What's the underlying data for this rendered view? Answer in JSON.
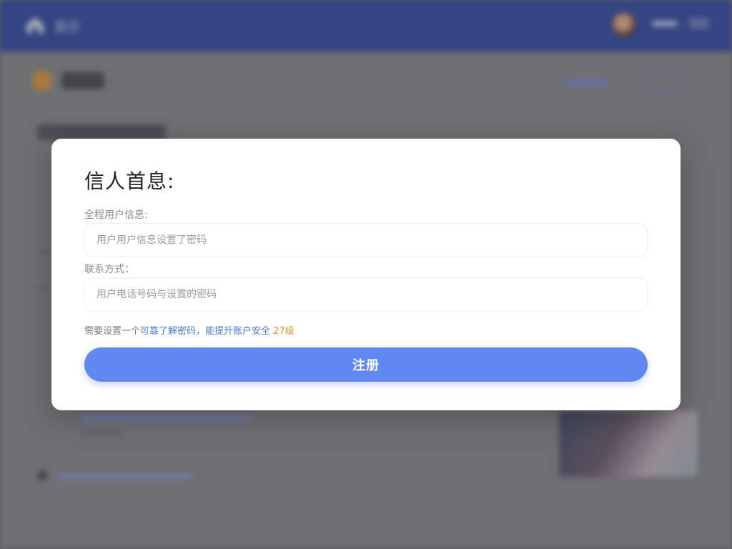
{
  "background": {
    "header": {
      "home_label": "首页"
    }
  },
  "modal": {
    "title": "信人首息:",
    "fields": [
      {
        "label": "全程用户信息:",
        "value": "",
        "placeholder": "用户用户信息设置了密码"
      },
      {
        "label": "联系方式：",
        "value": "",
        "placeholder": "用户电话号码与设置的密码"
      }
    ],
    "hint": {
      "prefix": "需要设置一个",
      "middle": "可靠了解密码，能提升账户安全",
      "suffix": "27级"
    },
    "submit_label": "注册"
  },
  "colors": {
    "header": "#2f4aa6",
    "accent": "#6188f0",
    "hint_blue": "#4f77d8",
    "hint_orange": "#e6943a"
  }
}
